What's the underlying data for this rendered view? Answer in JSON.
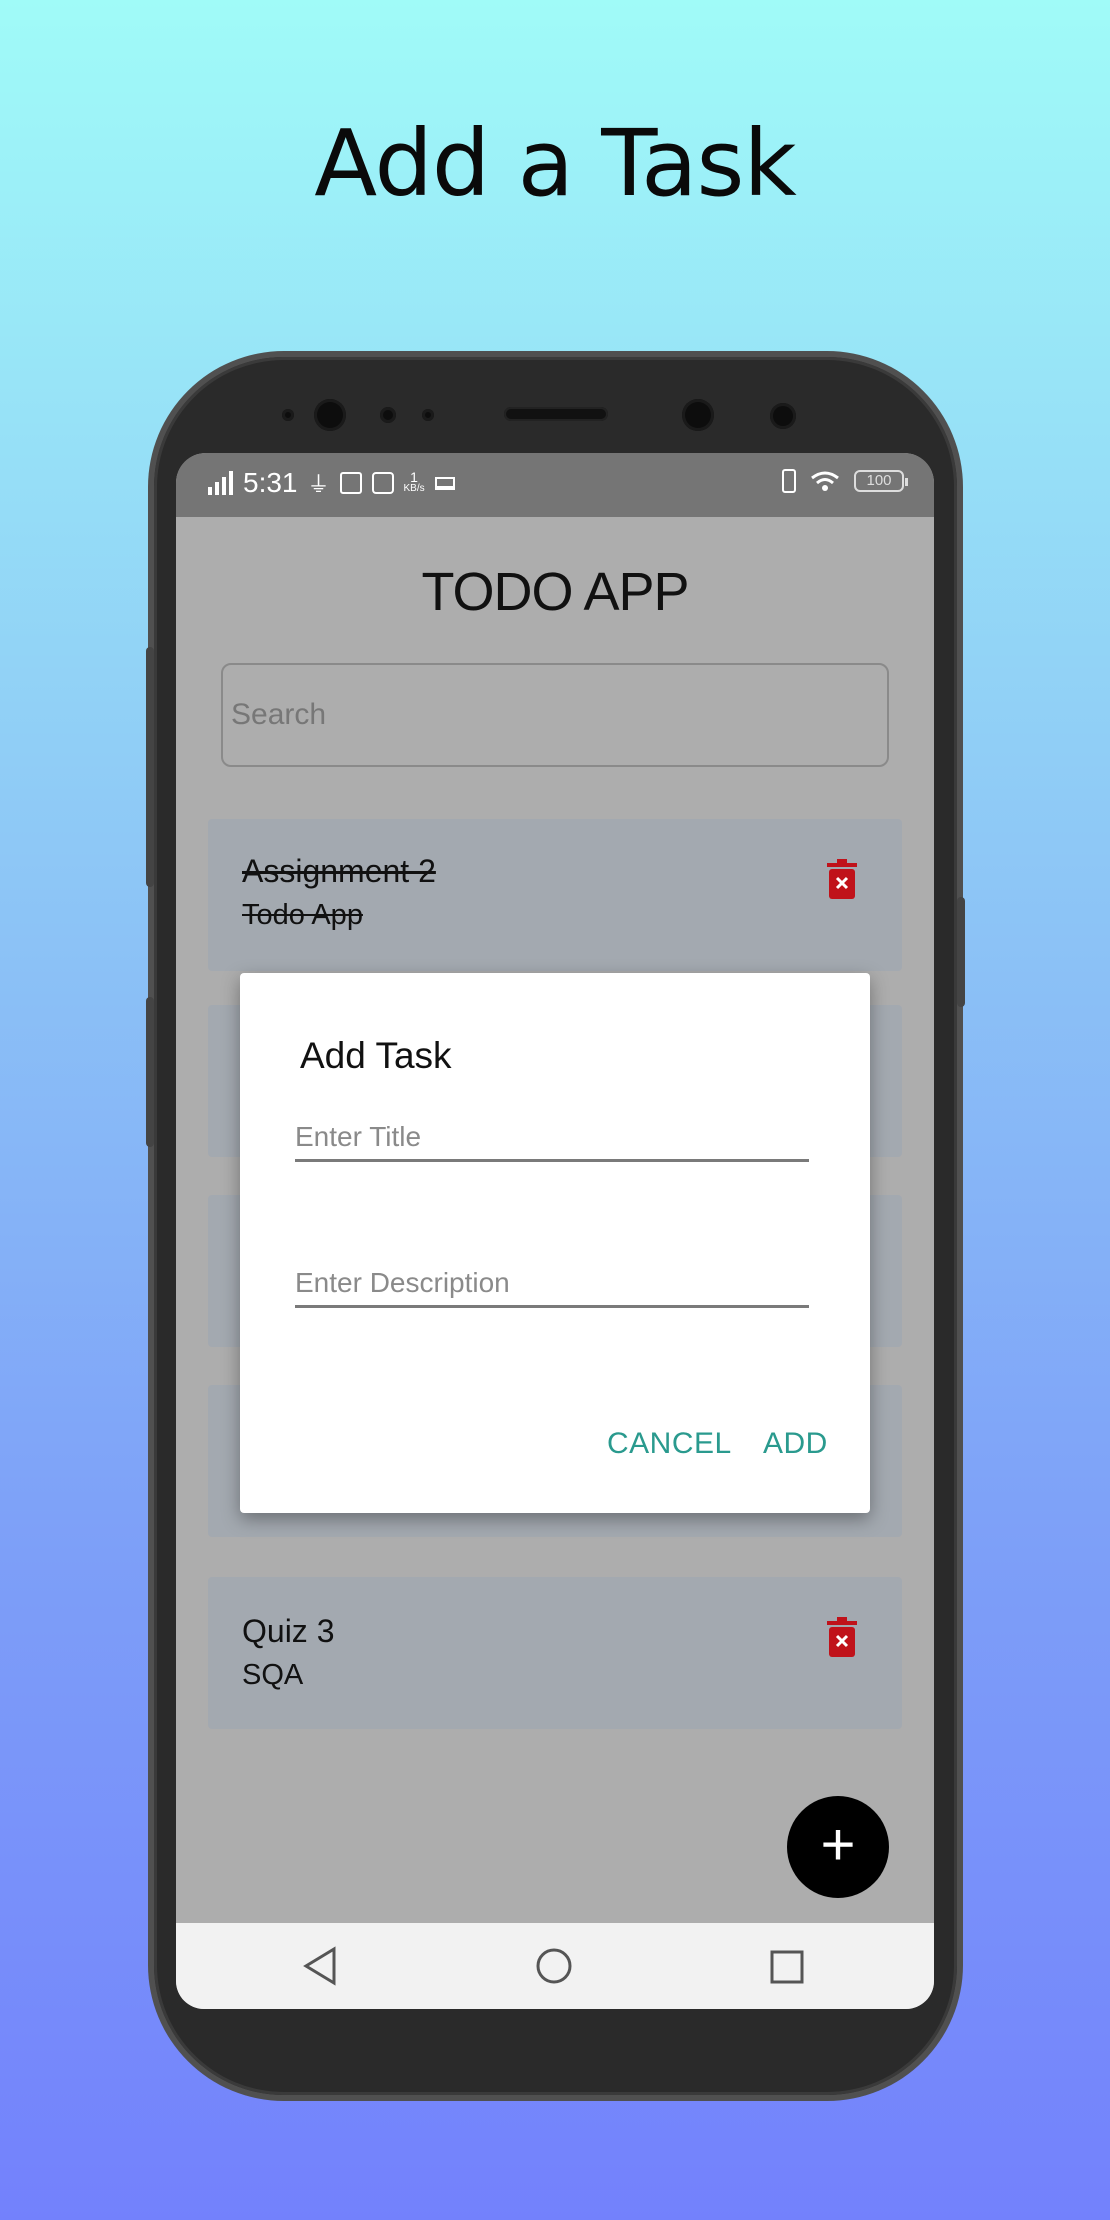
{
  "headline": "Add a Task",
  "status_bar": {
    "time": "5:31",
    "network_speed": "1",
    "network_unit": "KB/s",
    "battery": "100",
    "icons": [
      "signal-icon",
      "usb-icon",
      "sd-card-icon",
      "clipboard-check-icon",
      "laptop-icon",
      "vibrate-icon",
      "wifi-icon",
      "battery-icon"
    ]
  },
  "app": {
    "title": "TODO APP",
    "search_placeholder": "Search"
  },
  "tasks": [
    {
      "title": "Assignment 2",
      "description": "Todo App",
      "completed": true
    },
    {
      "title": "Quiz 3",
      "description": "SQA",
      "completed": false
    }
  ],
  "dialog": {
    "title": "Add Task",
    "title_placeholder": "Enter Title",
    "description_placeholder": "Enter Description",
    "cancel_label": "CANCEL",
    "add_label": "ADD"
  },
  "fab_label": "+",
  "colors": {
    "accent": "#2a9a8e",
    "trash": "#c0121a",
    "card": "#a3a9b0",
    "scrim_background": "#adadad"
  }
}
